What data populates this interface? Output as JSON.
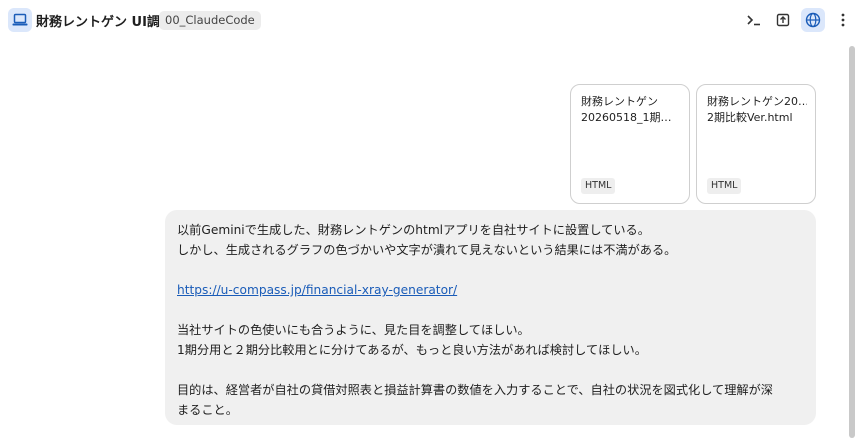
{
  "header": {
    "title": "財務レントゲン UI調整",
    "project": "00_ClaudeCode",
    "icons": [
      "laptop-icon",
      "terminal-icon",
      "export-icon",
      "globe-icon",
      "more-vert-icon"
    ],
    "accent_color": "#dbe7fb"
  },
  "attachments": [
    {
      "name_line1": "財務レントゲン",
      "name_line2": "20260518_1期…",
      "type": "HTML"
    },
    {
      "name_line1": "財務レントゲン20…",
      "name_line2": "2期比較Ver.html",
      "type": "HTML"
    }
  ],
  "message": {
    "p1_line1": "以前Geminiで生成した、財務レントゲンのhtmlアプリを自社サイトに設置している。",
    "p1_line2": "しかし、生成されるグラフの色づかいや文字が潰れて見えないという結果には不満がある。",
    "link": "https://u-compass.jp/financial-xray-generator/",
    "p2_line1": "当社サイトの色使いにも合うように、見た目を調整してほしい。",
    "p2_line2": "1期分用と２期分比較用とに分けてあるが、もっと良い方法があれば検討してほしい。",
    "p3_line1": "目的は、経営者が自社の貸借対照表と損益計算書の数値を入力することで、自社の状況を図式化して理解が深",
    "p3_line2": "まること。"
  }
}
